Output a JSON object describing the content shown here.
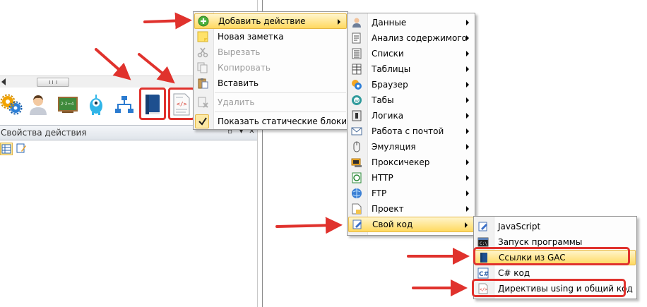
{
  "left_panel": {
    "title": "Свойства действия",
    "toolbar_icons": [
      "gears-icon",
      "user-icon",
      "chalkboard-icon",
      "alien-icon",
      "tree-network-icon",
      "book-icon",
      "code-file-icon"
    ]
  },
  "main_menu": {
    "items": [
      {
        "label": "Добавить действие",
        "icon": "add-green-icon",
        "state": "active",
        "submenu": true
      },
      {
        "label": "Новая заметка",
        "icon": "note-icon",
        "state": "normal"
      },
      {
        "label": "Вырезать",
        "icon": "scissors-icon",
        "state": "disabled"
      },
      {
        "label": "Копировать",
        "icon": "copy-icon",
        "state": "disabled"
      },
      {
        "label": "Вставить",
        "icon": "paste-icon",
        "state": "normal"
      },
      {
        "label": "Удалить",
        "icon": "delete-icon",
        "state": "disabled"
      },
      {
        "label": "Показать статические блоки",
        "icon": "check-icon",
        "state": "checked"
      }
    ]
  },
  "action_menu": {
    "items": [
      {
        "label": "Данные",
        "icon": "person-data-icon"
      },
      {
        "label": "Анализ содержимого",
        "icon": "analyze-icon"
      },
      {
        "label": "Списки",
        "icon": "list-icon"
      },
      {
        "label": "Таблицы",
        "icon": "table-icon"
      },
      {
        "label": "Браузер",
        "icon": "browser-icon"
      },
      {
        "label": "Табы",
        "icon": "tabs-icon"
      },
      {
        "label": "Логика",
        "icon": "logic-icon"
      },
      {
        "label": "Работа с почтой",
        "icon": "mail-icon"
      },
      {
        "label": "Эмуляция",
        "icon": "mouse-icon"
      },
      {
        "label": "Проксичекер",
        "icon": "proxy-icon"
      },
      {
        "label": "HTTP",
        "icon": "http-icon"
      },
      {
        "label": "FTP",
        "icon": "ftp-icon"
      },
      {
        "label": "Проект",
        "icon": "project-icon"
      },
      {
        "label": "Свой код",
        "icon": "custom-code-icon",
        "state": "active"
      }
    ]
  },
  "code_menu": {
    "items": [
      {
        "label": "JavaScript",
        "icon": "javascript-icon"
      },
      {
        "label": "Запуск программы",
        "icon": "run-program-icon"
      },
      {
        "label": "Ссылки из GAC",
        "icon": "gac-book-icon",
        "state": "active"
      },
      {
        "label": "C# код",
        "icon": "csharp-icon"
      },
      {
        "label": "Директивы using и общий код",
        "icon": "using-directives-icon"
      }
    ]
  },
  "colors": {
    "highlight_red": "#e0322d",
    "active_item": "#ffd95f"
  }
}
